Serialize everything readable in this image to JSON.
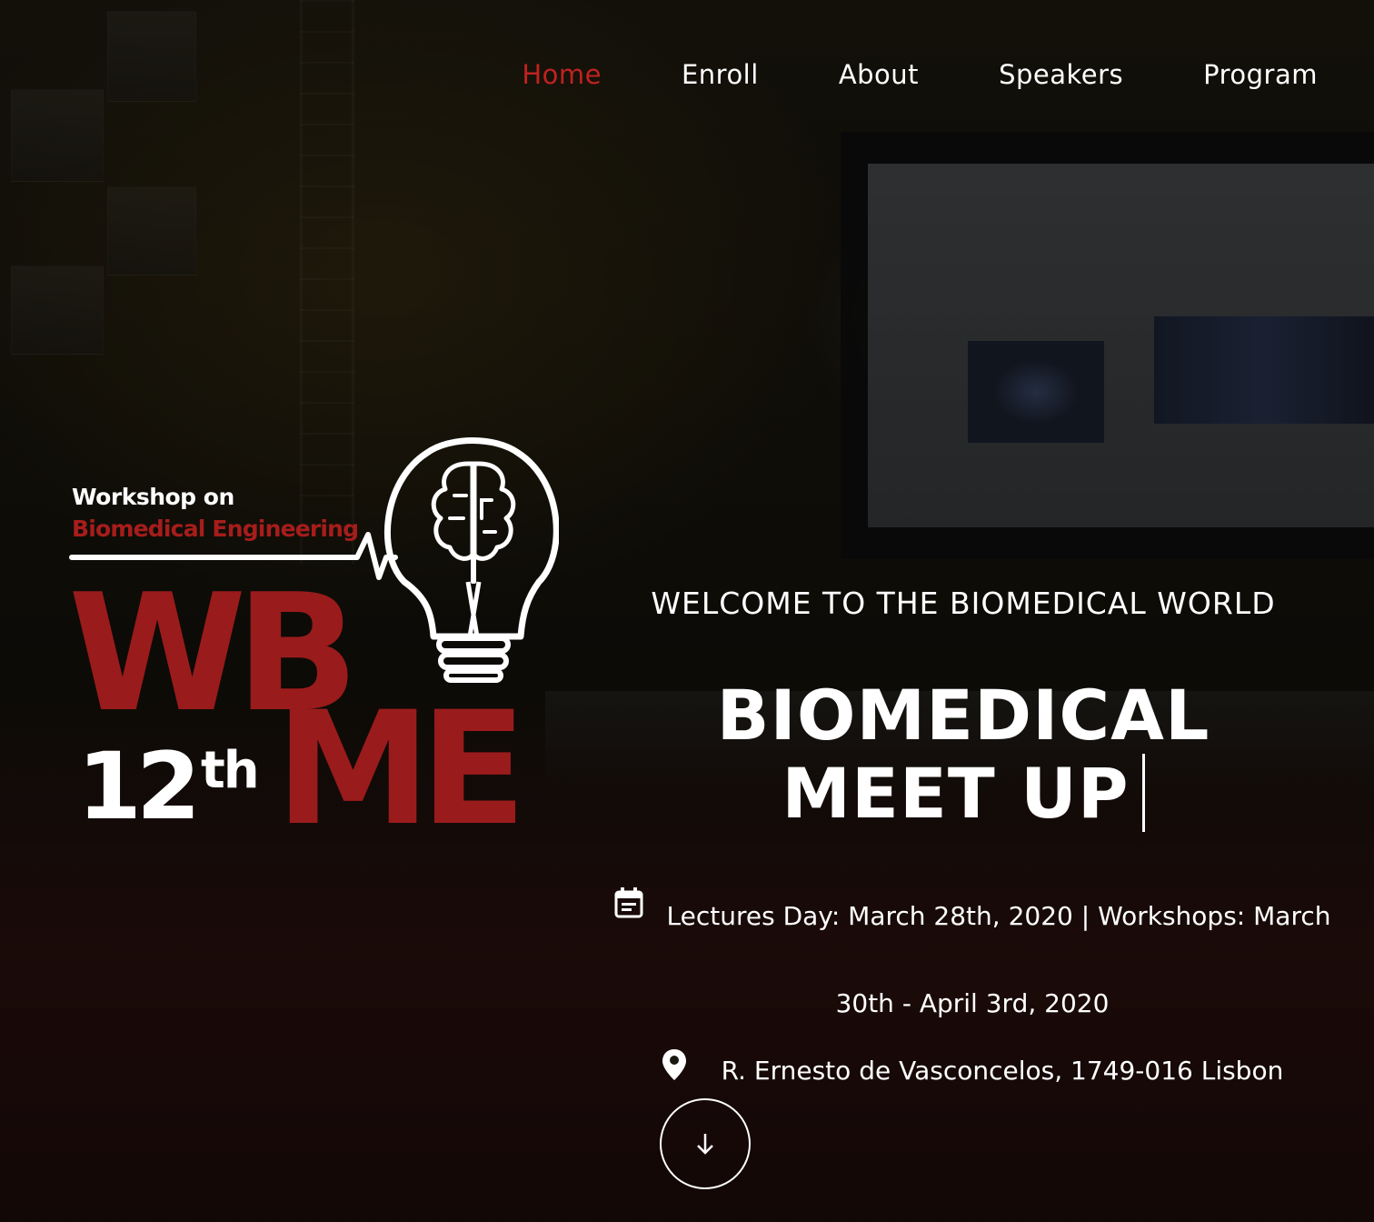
{
  "nav": {
    "items": [
      {
        "label": "Home",
        "active": true
      },
      {
        "label": "Enroll",
        "active": false
      },
      {
        "label": "About",
        "active": false
      },
      {
        "label": "Speakers",
        "active": false
      },
      {
        "label": "Program",
        "active": false
      }
    ]
  },
  "logo": {
    "line1": "Workshop on",
    "line2": "Biomedical Engineering",
    "letters_top": "WB",
    "letters_bottom": "ME",
    "edition_number": "12",
    "edition_suffix": "th",
    "icon": "lightbulb-brain-icon"
  },
  "hero": {
    "welcome": "WELCOME TO THE BIOMEDICAL WORLD",
    "title_line1": "BIOMEDICAL",
    "title_line2": "MEET UP",
    "dates_line1": "Lectures Day: March 28th, 2020 | Workshops: March",
    "dates_line2": "30th - April 3rd, 2020",
    "location": "R. Ernesto de Vasconcelos, 1749-016 Lisbon"
  },
  "icons": {
    "calendar": "calendar-icon",
    "location": "map-pin-icon",
    "scroll": "arrow-down-icon"
  },
  "colors": {
    "accent": "#c0221f",
    "logo_red": "#9a1b1b",
    "text": "#ffffff"
  }
}
